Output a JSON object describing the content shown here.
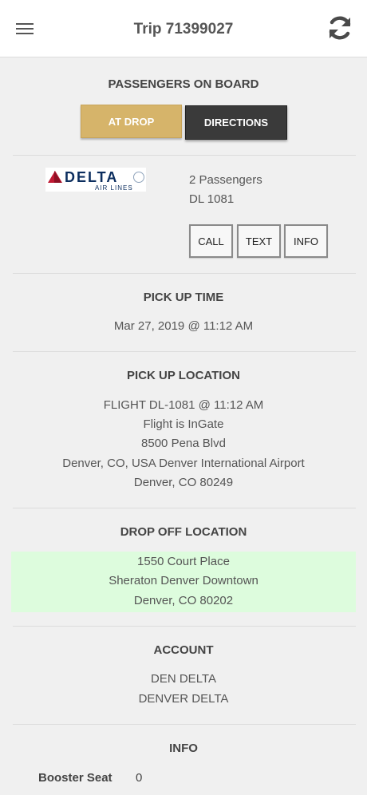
{
  "header": {
    "title": "Trip 71399027",
    "menu_icon": "hamburger-icon",
    "refresh_icon": "refresh-icon"
  },
  "status": {
    "heading": "PASSENGERS ON BOARD",
    "at_drop_label": "AT DROP",
    "directions_label": "DIRECTIONS",
    "at_drop_color": "#d6b46a",
    "directions_color": "#3a3a3a"
  },
  "airline": {
    "logo_word": "DELTA",
    "logo_sub": "AIR LINES",
    "passengers": "2 Passengers",
    "flight": "DL 1081",
    "call_label": "CALL",
    "text_label": "TEXT",
    "info_label": "INFO"
  },
  "pickup_time": {
    "heading": "PICK UP TIME",
    "value": "Mar 27, 2019 @ 11:12 AM"
  },
  "pickup_location": {
    "heading": "PICK UP LOCATION",
    "lines": [
      "FLIGHT DL-1081 @ 11:12 AM",
      "Flight is InGate",
      "8500 Pena Blvd",
      "Denver, CO, USA Denver International Airport",
      "Denver, CO 80249"
    ]
  },
  "dropoff_location": {
    "heading": "DROP OFF LOCATION",
    "highlight_color": "#ddfcdd",
    "lines": [
      "1550 Court Place",
      "Sheraton Denver Downtown",
      "Denver, CO 80202"
    ]
  },
  "account": {
    "heading": "ACCOUNT",
    "lines": [
      "DEN DELTA",
      "DENVER DELTA"
    ]
  },
  "info": {
    "heading": "INFO",
    "booster_label": "Booster Seat",
    "booster_value": "0"
  }
}
